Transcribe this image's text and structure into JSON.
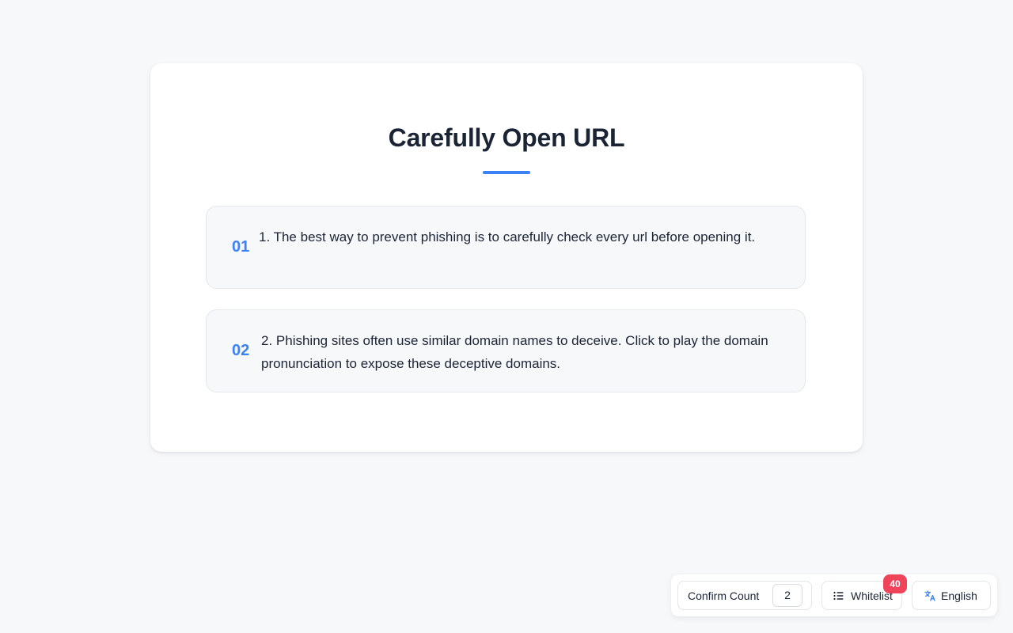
{
  "colors": {
    "accent": "#3b82f6",
    "badge": "#f0445b"
  },
  "page": {
    "title": "Carefully Open URL"
  },
  "tips": [
    {
      "number": "01",
      "text": "1. The best way to prevent phishing is to carefully check every url before opening it."
    },
    {
      "number": "02",
      "text": "2. Phishing sites often use similar domain names to deceive. Click to play the domain pronunciation to expose these deceptive domains."
    }
  ],
  "toolbar": {
    "confirm_count_label": "Confirm Count",
    "confirm_count_value": "2",
    "whitelist_label": "Whitelist",
    "whitelist_icon": "list-icon",
    "whitelist_count": "40",
    "language_label": "English",
    "language_icon": "translate-icon"
  }
}
